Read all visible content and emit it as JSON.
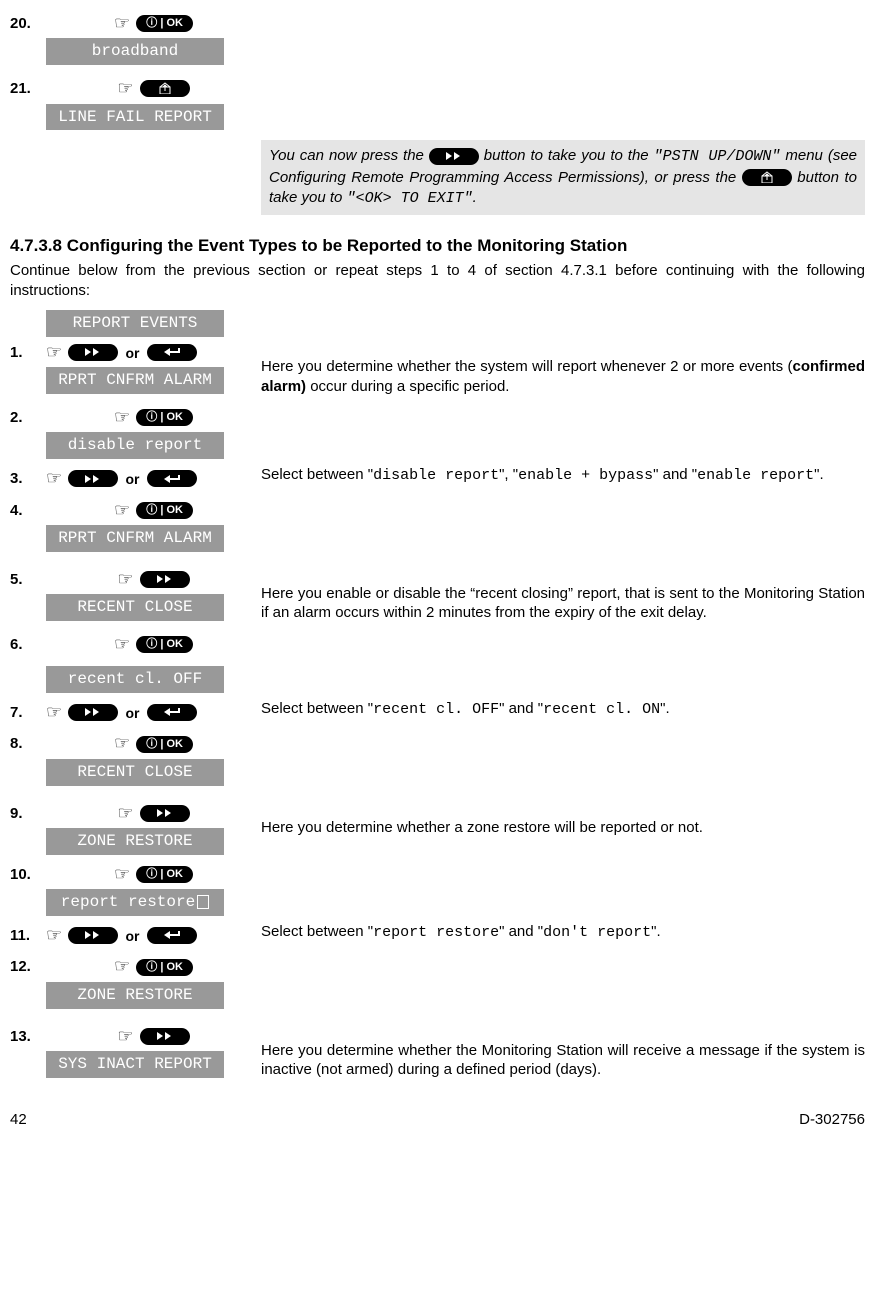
{
  "top_steps": {
    "s20": {
      "num": "20.",
      "lcd": "broadband"
    },
    "s21": {
      "num": "21.",
      "lcd": "LINE FAIL REPORT"
    }
  },
  "note": {
    "part1": "You can now press the ",
    "part2": " button to take you to the \"PSTN UP/DOWN\" menu (see Configuring Remote Programming Access Permissions), or press the ",
    "part3": " button to take you to \"<OK> TO EXIT\"."
  },
  "section_heading": "4.7.3.8 Configuring the Event Types to be Reported to the Monitoring Station",
  "intro": "Continue below from the previous section or repeat steps 1 to 4 of section 4.7.3.1 before continuing with the following instructions:",
  "header_lcd": "REPORT EVENTS",
  "common": {
    "or": "or"
  },
  "steps": {
    "s1": {
      "num": "1.",
      "lcd": "RPRT CNFRM ALARM",
      "desc_a": "Here you determine whether the system will report whenever 2 or more events (",
      "desc_b": "confirmed alarm)",
      "desc_c": " occur during a specific period."
    },
    "s2": {
      "num": "2.",
      "lcd": "disable report"
    },
    "s3": {
      "num": "3.",
      "desc_a": "Select between \"",
      "opt1": "disable report",
      "mid1": "\", \"",
      "opt2": "enable + bypass",
      "mid2": "\" and \"",
      "opt3": "enable report",
      "end": "\"."
    },
    "s4": {
      "num": "4.",
      "lcd": "RPRT CNFRM ALARM"
    },
    "s5": {
      "num": "5.",
      "lcd": "RECENT CLOSE",
      "desc": "Here you enable or disable the “recent closing” report, that is sent to the Monitoring Station if an alarm occurs within 2 minutes from the expiry of the exit delay."
    },
    "s6": {
      "num": "6.",
      "lcd": "recent cl. OFF"
    },
    "s7": {
      "num": "7.",
      "desc_a": "Select between \"",
      "opt1": "recent cl. OFF",
      "mid": "\" and \"",
      "opt2": "recent cl. ON",
      "end": "\"."
    },
    "s8": {
      "num": "8.",
      "lcd": "RECENT CLOSE"
    },
    "s9": {
      "num": "9.",
      "lcd": "ZONE RESTORE",
      "desc": "Here you determine whether a zone restore will be reported or not."
    },
    "s10": {
      "num": "10.",
      "lcd": "report restore"
    },
    "s11": {
      "num": "11.",
      "desc_a": "Select between \"",
      "opt1": "report restore",
      "mid": "\" and \"",
      "opt2": "don't report",
      "end": "\"."
    },
    "s12": {
      "num": "12.",
      "lcd": "ZONE RESTORE"
    },
    "s13": {
      "num": "13.",
      "lcd": "SYS INACT REPORT",
      "desc": "Here you determine whether the Monitoring Station will receive a message if the system is inactive (not armed) during a defined period (days)."
    }
  },
  "footer": {
    "page": "42",
    "doc": "D-302756"
  }
}
